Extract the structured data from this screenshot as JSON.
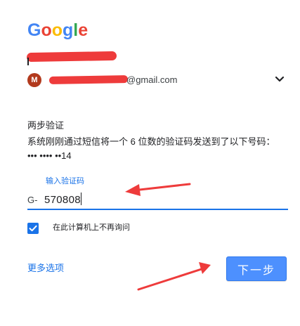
{
  "logo": {
    "letters": [
      "G",
      "o",
      "o",
      "g",
      "l",
      "e"
    ],
    "colors": [
      "#4285F4",
      "#EA4335",
      "#FBBC05",
      "#4285F4",
      "#34A853",
      "#EA4335"
    ]
  },
  "account": {
    "avatar_letter": "M",
    "email_visible": "@gmail.com",
    "chevron_icon": "chevron-down-icon"
  },
  "verification": {
    "title": "两步验证",
    "description": "系统刚刚通过短信将一个 6 位数的验证码发送到了以下号码：••• •••• ••14"
  },
  "code_field": {
    "label": "输入验证码",
    "prefix": "G-",
    "value": "570808"
  },
  "remember": {
    "checked": true,
    "label": "在此计算机上不再询问"
  },
  "actions": {
    "more_options": "更多选项",
    "next": "下一步"
  },
  "colors": {
    "accent": "#1a73e8",
    "button": "#4d90fe",
    "annotation": "#ee3b3b"
  }
}
